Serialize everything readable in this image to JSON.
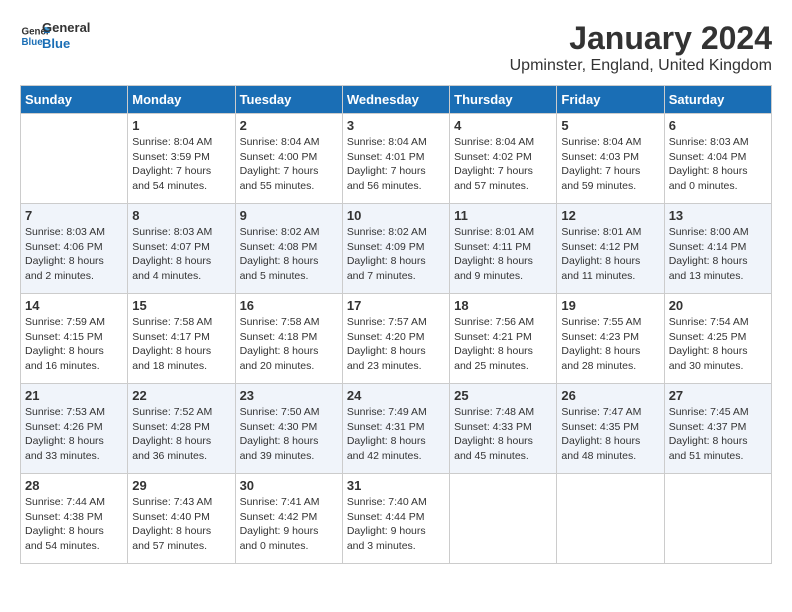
{
  "logo": {
    "text_general": "General",
    "text_blue": "Blue"
  },
  "title": "January 2024",
  "subtitle": "Upminster, England, United Kingdom",
  "days_of_week": [
    "Sunday",
    "Monday",
    "Tuesday",
    "Wednesday",
    "Thursday",
    "Friday",
    "Saturday"
  ],
  "weeks": [
    [
      {
        "day": "",
        "info": ""
      },
      {
        "day": "1",
        "info": "Sunrise: 8:04 AM\nSunset: 3:59 PM\nDaylight: 7 hours\nand 54 minutes."
      },
      {
        "day": "2",
        "info": "Sunrise: 8:04 AM\nSunset: 4:00 PM\nDaylight: 7 hours\nand 55 minutes."
      },
      {
        "day": "3",
        "info": "Sunrise: 8:04 AM\nSunset: 4:01 PM\nDaylight: 7 hours\nand 56 minutes."
      },
      {
        "day": "4",
        "info": "Sunrise: 8:04 AM\nSunset: 4:02 PM\nDaylight: 7 hours\nand 57 minutes."
      },
      {
        "day": "5",
        "info": "Sunrise: 8:04 AM\nSunset: 4:03 PM\nDaylight: 7 hours\nand 59 minutes."
      },
      {
        "day": "6",
        "info": "Sunrise: 8:03 AM\nSunset: 4:04 PM\nDaylight: 8 hours\nand 0 minutes."
      }
    ],
    [
      {
        "day": "7",
        "info": "Sunrise: 8:03 AM\nSunset: 4:06 PM\nDaylight: 8 hours\nand 2 minutes."
      },
      {
        "day": "8",
        "info": "Sunrise: 8:03 AM\nSunset: 4:07 PM\nDaylight: 8 hours\nand 4 minutes."
      },
      {
        "day": "9",
        "info": "Sunrise: 8:02 AM\nSunset: 4:08 PM\nDaylight: 8 hours\nand 5 minutes."
      },
      {
        "day": "10",
        "info": "Sunrise: 8:02 AM\nSunset: 4:09 PM\nDaylight: 8 hours\nand 7 minutes."
      },
      {
        "day": "11",
        "info": "Sunrise: 8:01 AM\nSunset: 4:11 PM\nDaylight: 8 hours\nand 9 minutes."
      },
      {
        "day": "12",
        "info": "Sunrise: 8:01 AM\nSunset: 4:12 PM\nDaylight: 8 hours\nand 11 minutes."
      },
      {
        "day": "13",
        "info": "Sunrise: 8:00 AM\nSunset: 4:14 PM\nDaylight: 8 hours\nand 13 minutes."
      }
    ],
    [
      {
        "day": "14",
        "info": "Sunrise: 7:59 AM\nSunset: 4:15 PM\nDaylight: 8 hours\nand 16 minutes."
      },
      {
        "day": "15",
        "info": "Sunrise: 7:58 AM\nSunset: 4:17 PM\nDaylight: 8 hours\nand 18 minutes."
      },
      {
        "day": "16",
        "info": "Sunrise: 7:58 AM\nSunset: 4:18 PM\nDaylight: 8 hours\nand 20 minutes."
      },
      {
        "day": "17",
        "info": "Sunrise: 7:57 AM\nSunset: 4:20 PM\nDaylight: 8 hours\nand 23 minutes."
      },
      {
        "day": "18",
        "info": "Sunrise: 7:56 AM\nSunset: 4:21 PM\nDaylight: 8 hours\nand 25 minutes."
      },
      {
        "day": "19",
        "info": "Sunrise: 7:55 AM\nSunset: 4:23 PM\nDaylight: 8 hours\nand 28 minutes."
      },
      {
        "day": "20",
        "info": "Sunrise: 7:54 AM\nSunset: 4:25 PM\nDaylight: 8 hours\nand 30 minutes."
      }
    ],
    [
      {
        "day": "21",
        "info": "Sunrise: 7:53 AM\nSunset: 4:26 PM\nDaylight: 8 hours\nand 33 minutes."
      },
      {
        "day": "22",
        "info": "Sunrise: 7:52 AM\nSunset: 4:28 PM\nDaylight: 8 hours\nand 36 minutes."
      },
      {
        "day": "23",
        "info": "Sunrise: 7:50 AM\nSunset: 4:30 PM\nDaylight: 8 hours\nand 39 minutes."
      },
      {
        "day": "24",
        "info": "Sunrise: 7:49 AM\nSunset: 4:31 PM\nDaylight: 8 hours\nand 42 minutes."
      },
      {
        "day": "25",
        "info": "Sunrise: 7:48 AM\nSunset: 4:33 PM\nDaylight: 8 hours\nand 45 minutes."
      },
      {
        "day": "26",
        "info": "Sunrise: 7:47 AM\nSunset: 4:35 PM\nDaylight: 8 hours\nand 48 minutes."
      },
      {
        "day": "27",
        "info": "Sunrise: 7:45 AM\nSunset: 4:37 PM\nDaylight: 8 hours\nand 51 minutes."
      }
    ],
    [
      {
        "day": "28",
        "info": "Sunrise: 7:44 AM\nSunset: 4:38 PM\nDaylight: 8 hours\nand 54 minutes."
      },
      {
        "day": "29",
        "info": "Sunrise: 7:43 AM\nSunset: 4:40 PM\nDaylight: 8 hours\nand 57 minutes."
      },
      {
        "day": "30",
        "info": "Sunrise: 7:41 AM\nSunset: 4:42 PM\nDaylight: 9 hours\nand 0 minutes."
      },
      {
        "day": "31",
        "info": "Sunrise: 7:40 AM\nSunset: 4:44 PM\nDaylight: 9 hours\nand 3 minutes."
      },
      {
        "day": "",
        "info": ""
      },
      {
        "day": "",
        "info": ""
      },
      {
        "day": "",
        "info": ""
      }
    ]
  ]
}
